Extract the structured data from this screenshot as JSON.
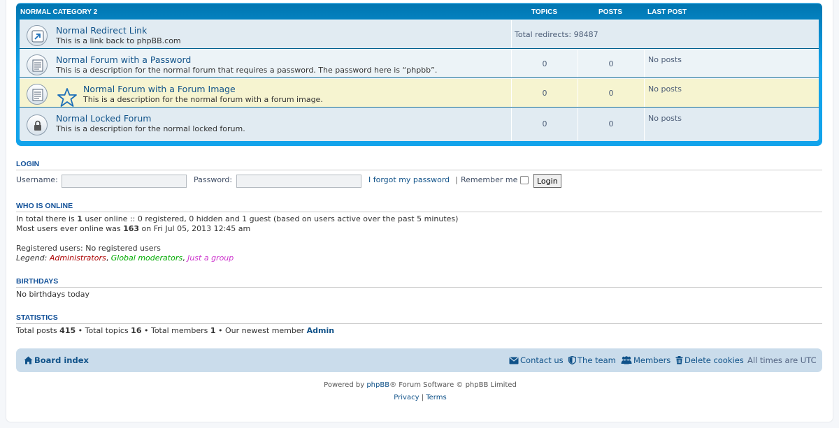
{
  "category": {
    "title": "NORMAL CATEGORY 2",
    "col_topics": "TOPICS",
    "col_posts": "POSTS",
    "col_lastpost": "LAST POST"
  },
  "forums": [
    {
      "title": "Normal Redirect Link",
      "description": "This is a link back to phpBB.com",
      "redirects": "Total redirects: 98487"
    },
    {
      "title": "Normal Forum with a Password",
      "description": "This is a description for the normal forum that requires a password. The password here is “phpbb”.",
      "topics": "0",
      "posts": "0",
      "last_post": "No posts"
    },
    {
      "title": "Normal Forum with a Forum Image",
      "description": "This is a description for the normal forum with a forum image.",
      "topics": "0",
      "posts": "0",
      "last_post": "No posts"
    },
    {
      "title": "Normal Locked Forum",
      "description": "This is a description for the normal locked forum.",
      "topics": "0",
      "posts": "0",
      "last_post": "No posts"
    }
  ],
  "login": {
    "heading": "LOGIN",
    "username_label": "Username:",
    "password_label": "Password:",
    "username_value": "",
    "password_value": "",
    "forgot_link": "I forgot my password",
    "separator": "|",
    "remember_label": "Remember me",
    "login_button": "Login"
  },
  "online": {
    "heading": "WHO IS ONLINE",
    "line1_a": "In total there is ",
    "line1_count": "1",
    "line1_b": " user online :: 0 registered, 0 hidden and 1 guest (based on users active over the past 5 minutes)",
    "line2_a": "Most users ever online was ",
    "line2_count": "163",
    "line2_b": " on Fri Jul 05, 2013 12:45 am",
    "registered": "Registered users: No registered users",
    "legend_label": "Legend:",
    "group_admin": "Administrators",
    "group_gmod": "Global moderators",
    "group_other": "Just a group",
    "comma": ","
  },
  "birthdays": {
    "heading": "BIRTHDAYS",
    "text": "No birthdays today"
  },
  "statistics": {
    "heading": "STATISTICS",
    "posts_label": "Total posts ",
    "posts": "415",
    "topics_label": " • Total topics ",
    "topics": "16",
    "members_label": " • Total members ",
    "members": "1",
    "newest_label": " • Our newest member ",
    "newest": "Admin"
  },
  "navbar": {
    "board_index": "Board index",
    "contact": "Contact us",
    "team": "The team",
    "members": "Members",
    "delete_cookies": "Delete cookies",
    "timezone": "All times are UTC"
  },
  "footer": {
    "powered_a": "Powered by ",
    "phpbb": "phpBB",
    "powered_b": "® Forum Software © phpBB Limited",
    "privacy": "Privacy",
    "sep": "|",
    "terms": "Terms"
  },
  "colors": {
    "header_blue": "#12A3EB",
    "row_light": "#ECF3F7",
    "row_alt": "#E1EBF2",
    "row_highlight": "#F6F4D0",
    "link": "#105289",
    "navbar": "#CADCEB"
  }
}
